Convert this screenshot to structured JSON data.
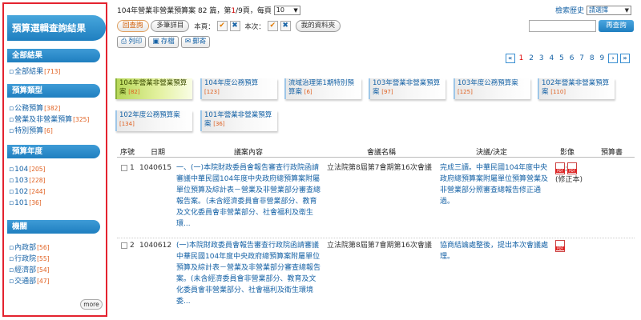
{
  "sidebar": {
    "title": "預算選輯查詢結果",
    "sections": [
      {
        "heading": "全部結果",
        "items": [
          {
            "label": "全部結果",
            "count": "[713]"
          }
        ]
      },
      {
        "heading": "預算類型",
        "items": [
          {
            "label": "公務預算",
            "count": "[382]"
          },
          {
            "label": "營業及非營業預算",
            "count": "[325]"
          },
          {
            "label": "特別預算",
            "count": "[6]"
          }
        ]
      },
      {
        "heading": "預算年度",
        "items": [
          {
            "label": "104",
            "count": "[205]"
          },
          {
            "label": "103",
            "count": "[228]"
          },
          {
            "label": "102",
            "count": "[244]"
          },
          {
            "label": "101",
            "count": "[36]"
          }
        ]
      },
      {
        "heading": "機關",
        "items": [
          {
            "label": "內政部",
            "count": "[56]"
          },
          {
            "label": "行政院",
            "count": "[55]"
          },
          {
            "label": "經濟部",
            "count": "[54]"
          },
          {
            "label": "交通部",
            "count": "[47]"
          }
        ]
      }
    ],
    "more_label": "more"
  },
  "header": {
    "summary_prefix": "104年營業非營業預算案 82 篇，第",
    "current_page": "1",
    "summary_mid": "/9頁，每頁",
    "per_page": "10",
    "history_label": "檢索歷史",
    "history_select": "請選擇"
  },
  "toolbar": {
    "back_label": "回查詢",
    "detail_label": "多筆詳目",
    "this_page_label": "本頁：",
    "this_time_label": "本次：",
    "my_files_label": "我的資料夾",
    "research_label": "再查詢",
    "print_label": "列印",
    "save_label": "存檔",
    "mail_label": "郵寄"
  },
  "pager": {
    "pages": [
      "1",
      "2",
      "3",
      "4",
      "5",
      "6",
      "7",
      "8",
      "9"
    ],
    "current": "1"
  },
  "tabs": [
    {
      "label": "104年營業非營業預算案",
      "count": "[82]",
      "active": true
    },
    {
      "label": "104年度公務預算",
      "count": "[123]"
    },
    {
      "label": "流域治理第1期特別預算案",
      "count": "[6]"
    },
    {
      "label": "103年營業非營業預算案",
      "count": "[97]"
    },
    {
      "label": "103年度公務預算案",
      "count": "[125]"
    },
    {
      "label": "102年營業非營業預算案",
      "count": "[110]"
    },
    {
      "label": "102年度公務預算案",
      "count": "[134]"
    },
    {
      "label": "101年營業非營業預算案",
      "count": "[36]"
    }
  ],
  "table": {
    "headers": [
      "序號",
      "日期",
      "議案內容",
      "會議名稱",
      "決議/決定",
      "影像",
      "預算書"
    ],
    "rows": [
      {
        "index": "1",
        "date": "1040615",
        "content": "一、(一)本院財政委員會報告審查行政院函請審議中華民國104年度中央政府總預算案附屬單位預算及綜計表－營業及非營業部分審查總報告案。（未含經濟委員會非營業部分、教育及文化委員會非營業部分、社會福利及衛生環...",
        "meeting": "立法院第8屆第7會期第16次會議",
        "decision": "完成三讀。中華民國104年度中央政府總預算案附屬單位預算營業及非營業部分照審查總報告修正通過。",
        "image_note": "(修正本)"
      },
      {
        "index": "2",
        "date": "1040612",
        "content": "(一)本院財政委員會報告審查行政院函請審議中華民國104年度中央政府總預算案附屬單位預算及綜計表－營業及非營業部分審查總報告案。(未含經濟委員會非營業部分、教育及文化委員會非營業部分、社會福利及衛生環境委...",
        "meeting": "立法院第8屆第7會期第16次會議",
        "decision": "協商結論處整後，提出本次會議處理。",
        "image_note": ""
      }
    ]
  },
  "colors": {
    "accent": "#1f7fc0",
    "sidebar_border": "#e4232f",
    "active_tab": "#b8d85a",
    "count": "#e06020"
  }
}
